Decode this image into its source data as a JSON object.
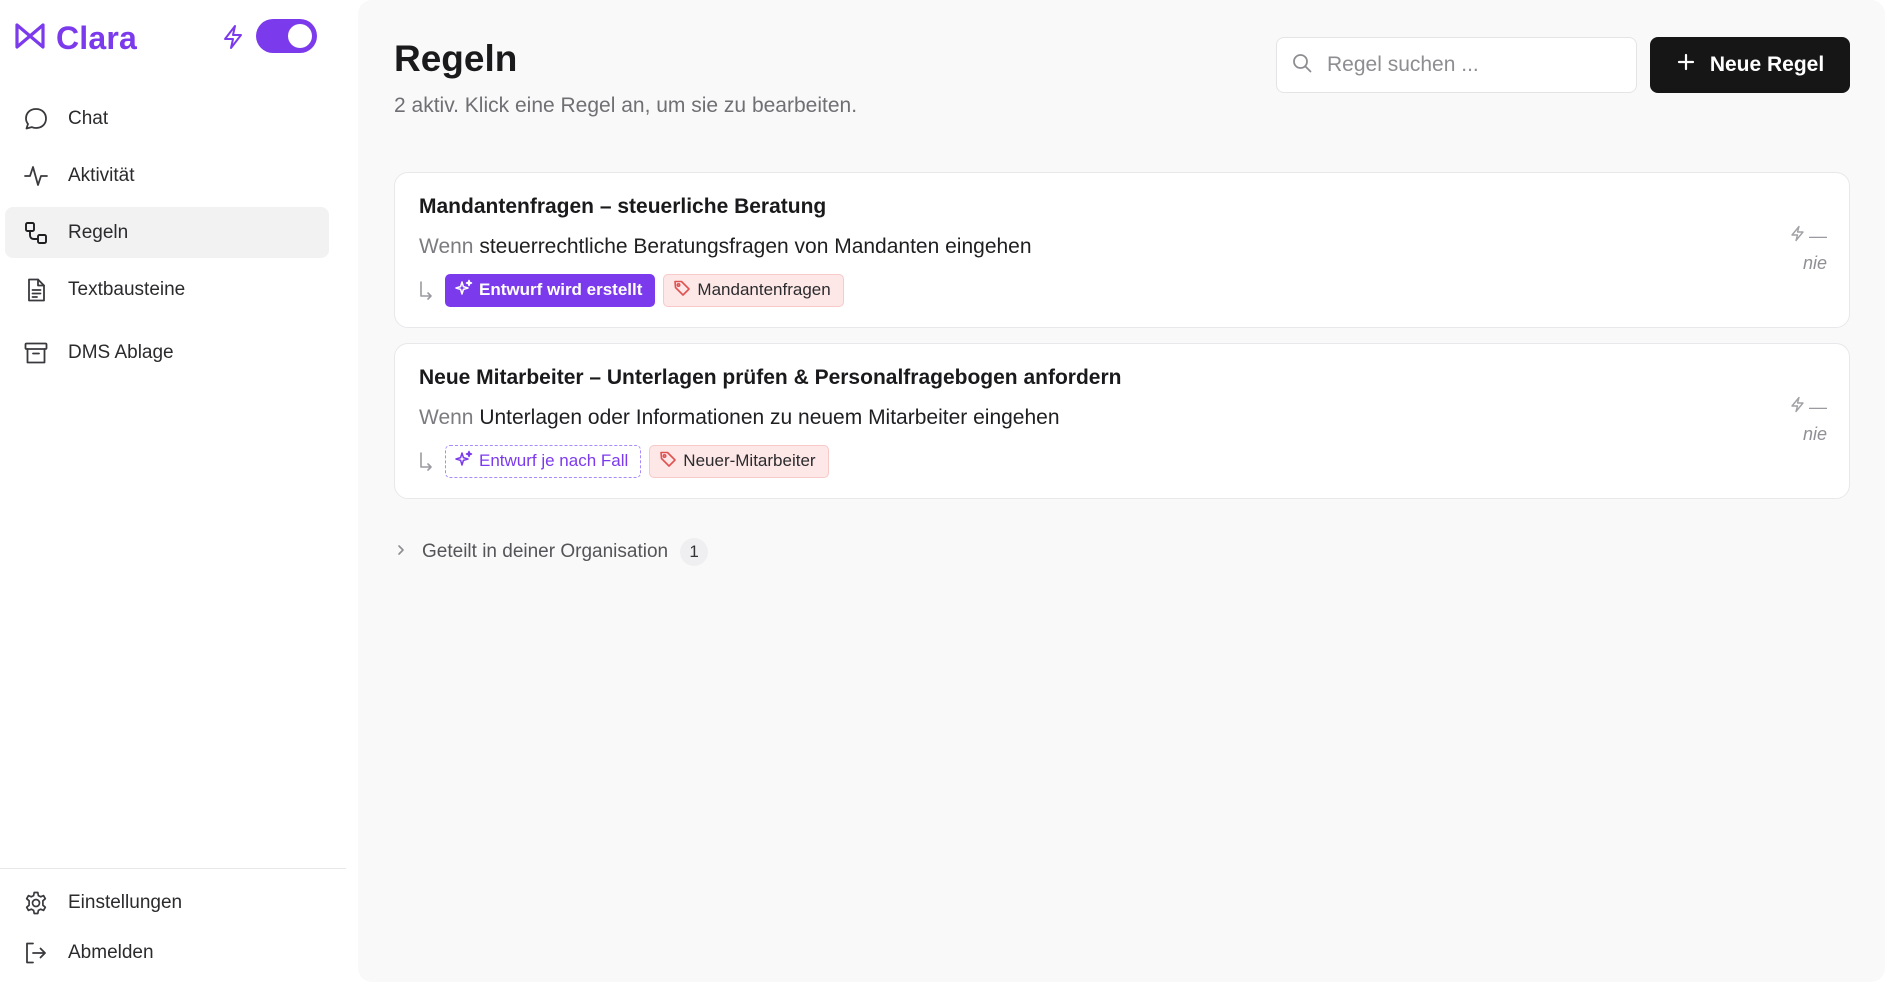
{
  "app": {
    "name": "Clara",
    "brand_color": "#7c3aed",
    "logo_icon": "bowtie-logo-icon",
    "auto_mode": {
      "icon": "lightning-icon",
      "enabled": true
    }
  },
  "sidebar": {
    "items": [
      {
        "label": "Chat",
        "icon": "chat-bubble-icon",
        "active": false
      },
      {
        "label": "Aktivität",
        "icon": "activity-pulse-icon",
        "active": false
      },
      {
        "label": "Regeln",
        "icon": "workflow-rules-icon",
        "active": true
      },
      {
        "label": "Textbausteine",
        "icon": "document-text-icon",
        "active": false
      },
      {
        "label": "DMS Ablage",
        "icon": "archive-box-icon",
        "active": false
      }
    ],
    "bottom": [
      {
        "label": "Einstellungen",
        "icon": "gear-icon"
      },
      {
        "label": "Abmelden",
        "icon": "logout-icon"
      }
    ]
  },
  "main": {
    "title": "Regeln",
    "subtitle": "2 aktiv. Klick eine Regel an, um sie zu bearbeiten.",
    "search": {
      "placeholder": "Regel suchen ...",
      "value": "",
      "icon": "search-icon"
    },
    "new_button": {
      "label": "Neue Regel",
      "icon": "plus-icon"
    },
    "rules": [
      {
        "title": "Mandantenfragen – steuerliche Beratung",
        "when_keyword": "Wenn",
        "when_text": "steuerrechtliche Beratungsfragen von Mandanten eingehen",
        "action": {
          "label": "Entwurf wird erstellt",
          "style": "solid",
          "icon": "sparkles-icon"
        },
        "tag": {
          "label": "Mandantenfragen",
          "icon": "tag-icon"
        },
        "stat_value": "—",
        "last_run": "nie"
      },
      {
        "title": "Neue Mitarbeiter – Unterlagen prüfen & Personalfragebogen anfordern",
        "when_keyword": "Wenn",
        "when_text": "Unterlagen oder Informationen zu neuem Mitarbeiter eingehen",
        "action": {
          "label": "Entwurf je nach Fall",
          "style": "dashed",
          "icon": "sparkles-icon"
        },
        "tag": {
          "label": "Neuer-Mitarbeiter",
          "icon": "tag-icon"
        },
        "stat_value": "—",
        "last_run": "nie"
      }
    ],
    "shared": {
      "label": "Geteilt in deiner Organisation",
      "count": "1",
      "icon": "chevron-right-icon"
    }
  }
}
